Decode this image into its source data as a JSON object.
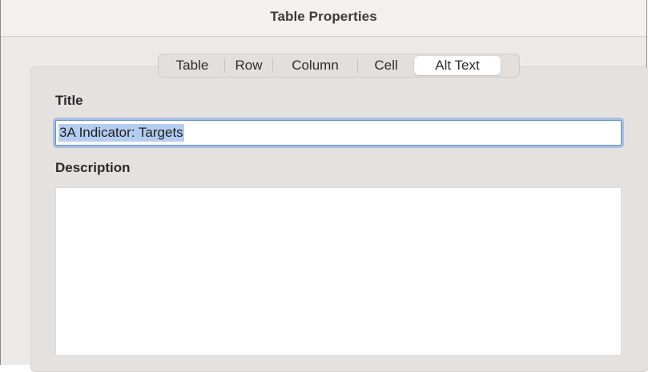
{
  "window": {
    "title": "Table Properties"
  },
  "tabs": [
    {
      "label": "Table",
      "selected": false
    },
    {
      "label": "Row",
      "selected": false
    },
    {
      "label": "Column",
      "selected": false
    },
    {
      "label": "Cell",
      "selected": false
    },
    {
      "label": "Alt Text",
      "selected": true
    }
  ],
  "form": {
    "title_label": "Title",
    "title_value": "3A Indicator: Targets",
    "description_label": "Description",
    "description_value": ""
  },
  "colors": {
    "focus_ring": "#a6bfe3",
    "selection_highlight": "#b3cdf1",
    "window_background": "#ece9e6"
  }
}
